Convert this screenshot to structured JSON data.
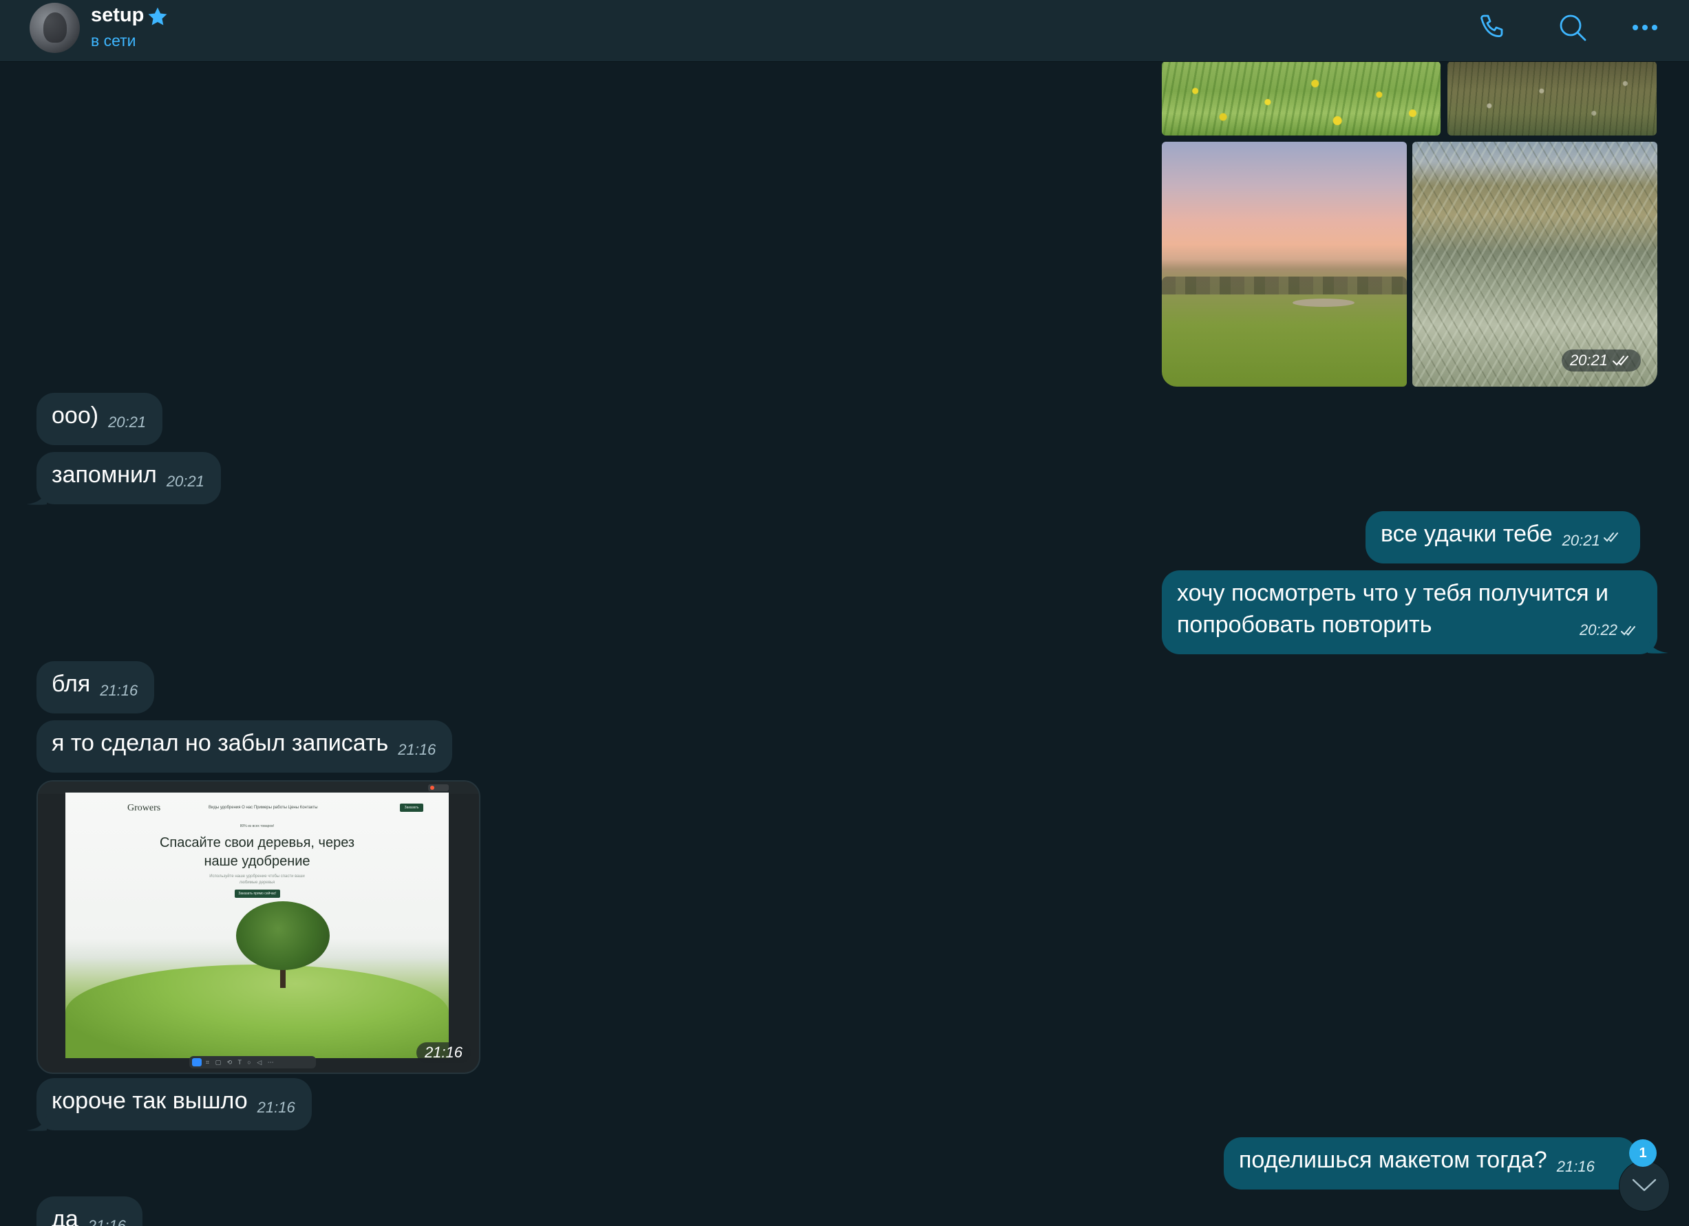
{
  "header": {
    "contact_name": "setup",
    "status": "в сети",
    "icons": [
      "phone-icon",
      "search-icon",
      "more-icon"
    ]
  },
  "colors": {
    "accent": "#3eb6ff",
    "incoming_bubble": "#1c2f38",
    "outgoing_bubble": "#0c5569",
    "background": "#0f1c23"
  },
  "media_album": {
    "time": "20:21",
    "status": "read"
  },
  "messages": [
    {
      "dir": "in",
      "text": "ооо)",
      "time": "20:21"
    },
    {
      "dir": "in",
      "text": "запомнил",
      "time": "20:21"
    },
    {
      "dir": "out",
      "text": "все удачки тебе",
      "time": "20:21",
      "status": "read"
    },
    {
      "dir": "out",
      "text": "хочу посмотреть что у тебя получится и попробовать повторить",
      "time": "20:22",
      "status": "read"
    },
    {
      "dir": "in",
      "text": "бля",
      "time": "21:16"
    },
    {
      "dir": "in",
      "text": "я то сделал но забыл записать",
      "time": "21:16"
    },
    {
      "dir": "in",
      "text": "короче так вышло",
      "time": "21:16"
    },
    {
      "dir": "out",
      "text": "поделишься макетом тогда?",
      "time": "21:16",
      "status": "read"
    },
    {
      "dir": "in",
      "text": "да",
      "time": "21:16"
    }
  ],
  "screenshot": {
    "time": "21:16",
    "logo": "Growers",
    "nav": "Виды удобрения   О нас   Примеры работы   Цены   Контакты",
    "nav_button": "Заказать",
    "eyebrow": "80% из всех товаров!",
    "heading": "Спасайте свои деревья, через наше удобрение",
    "subheading": "Используйте наше удобрение чтобы спасти ваши любимые деревья",
    "cta": "Заказать прямо сейчас!"
  },
  "scroll_down": {
    "unread_count": "1"
  }
}
